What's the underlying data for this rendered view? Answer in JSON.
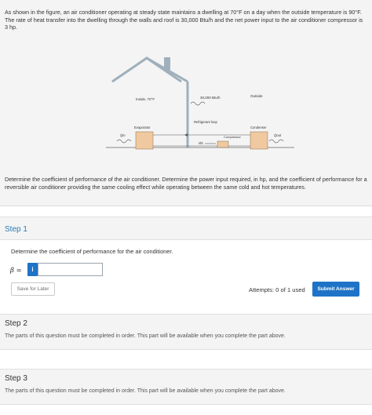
{
  "problem": {
    "statement": "As shown in the figure, an air conditioner operating at steady state maintains a dwelling at 70°F on a day when the outside temperature is 90°F. The rate of heat transfer into the dwelling through the walls and roof is 30,000 Btu/h and the net power input to the air conditioner compressor is 3 hp.",
    "question": "Determine the coefficient of performance of the air conditioner. Determine the power input required, in hp, and the coefficient of performance for a reversible air conditioner providing the same cooling effect while operating between the same cold and hot temperatures."
  },
  "figure": {
    "inside_label": "Inside, 70°F",
    "outside_label": "Outside",
    "heat_label": "30,000 Btu/h",
    "loop_label": "Refrigerant loop",
    "compressor_label": "Compressor",
    "evaporator_label": "Evaporator",
    "condenser_label": "Condenser",
    "w_label": "Ẇc",
    "qin_label": "Q̇in",
    "qout_label": "Q̇out"
  },
  "step1": {
    "title": "Step 1",
    "prompt": "Determine the coefficient of performance for the air conditioner.",
    "beta_label": "β =",
    "info_icon": "i",
    "input_value": "",
    "save_label": "Save for Later",
    "attempts_text": "Attempts: 0 of 1 used",
    "submit_label": "Submit Answer"
  },
  "step2": {
    "title": "Step 2",
    "locked_text": "The parts of this question must be completed in order. This part will be available when you complete the part above."
  },
  "step3": {
    "title": "Step 3",
    "locked_text": "The parts of this question must be completed in order. This part will be available when you complete the part above."
  },
  "colors": {
    "accent": "#1e73c7",
    "step_title": "#2a7ab8",
    "unit_box": "#f0c9a0"
  }
}
